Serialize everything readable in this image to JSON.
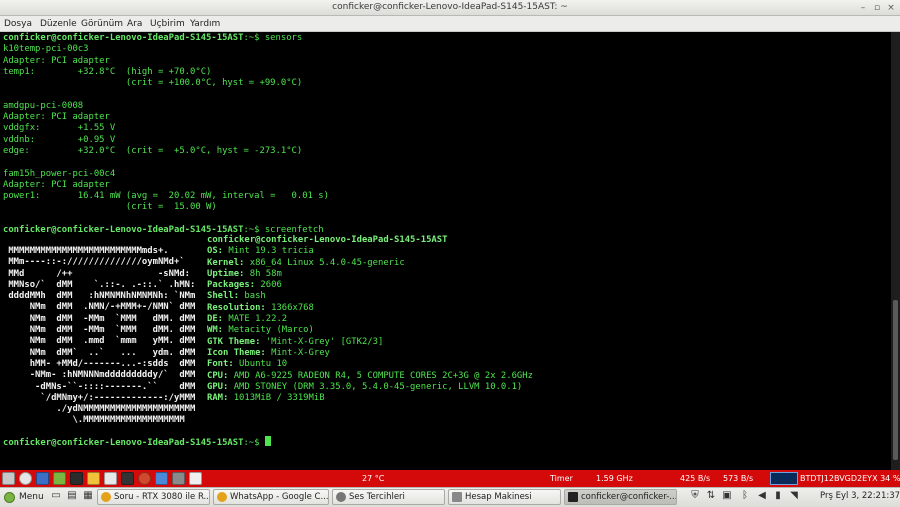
{
  "window": {
    "title": "conficker@conficker-Lenovo-IdeaPad-S145-15AST: ~",
    "minimize_glyph": "–",
    "maximize_glyph": "▫",
    "close_glyph": "×"
  },
  "menubar": [
    "Dosya",
    "Düzenle",
    "Görünüm",
    "Ara",
    "Uçbirim",
    "Yardım"
  ],
  "prompt": "conficker@conficker-Lenovo-IdeaPad-S145-15AST",
  "prompt_suffix": ":~$",
  "commands": {
    "first": " sensors",
    "second": " screenfetch",
    "third": " "
  },
  "sensors_output": [
    "k10temp-pci-00c3",
    "Adapter: PCI adapter",
    "temp1:        +32.8°C  (high = +70.0°C)",
    "                       (crit = +100.0°C, hyst = +99.0°C)",
    "",
    "amdgpu-pci-0008",
    "Adapter: PCI adapter",
    "vddgfx:       +1.55 V",
    "vddnb:        +0.95 V",
    "edge:         +32.0°C  (crit =  +5.0°C, hyst = -273.1°C)",
    "",
    "fam15h_power-pci-00c4",
    "Adapter: PCI adapter",
    "power1:       16.41 mW (avg =  20.02 mW, interval =   0.01 s)",
    "                       (crit =  15.00 W)",
    ""
  ],
  "logo_lines": [
    " MMMMMMMMMMMMMMMMMMMMMMMMMmds+.",
    " MMm----::-://////////////oymNMd+`",
    " MMd      /++                -sNMd:",
    " MMNso/`  dMM    `.::-. .-::.` .hMN:",
    " ddddMMh  dMM   :hNMNMNhNMNMNh: `NMm",
    "     NMm  dMM  .NMN/-+MMM+-/NMN` dMM",
    "     NMm  dMM  -MMm  `MMM   dMM. dMM",
    "     NMm  dMM  -MMm  `MMM   dMM. dMM",
    "     NMm  dMM  .mmd  `mmm   yMM. dMM",
    "     NMm  dMM`  ..`   ...   ydm. dMM",
    "     hMM- +MMd/-------...-:sdds  dMM",
    "     -NMm- :hNMNNNmdddddddddy/`  dMM",
    "      -dMNs-``-::::-------.``    dMM",
    "       `/dMNmy+/:-------------:/yMMM",
    "          ./ydNMMMMMMMMMMMMMMMMMMMMM",
    "             \\.MMMMMMMMMMMMMMMMMMM"
  ],
  "screenfetch": {
    "header": "conficker@conficker-Lenovo-IdeaPad-S145-15AST",
    "items": [
      {
        "label": "OS:",
        "value": " Mint 19.3 tricia"
      },
      {
        "label": "Kernel:",
        "value": " x86_64 Linux 5.4.0-45-generic"
      },
      {
        "label": "Uptime:",
        "value": " 8h 58m"
      },
      {
        "label": "Packages:",
        "value": " 2606"
      },
      {
        "label": "Shell:",
        "value": " bash"
      },
      {
        "label": "Resolution:",
        "value": " 1366x768"
      },
      {
        "label": "DE:",
        "value": " MATE 1.22.2"
      },
      {
        "label": "WM:",
        "value": " Metacity (Marco)"
      },
      {
        "label": "GTK Theme:",
        "value": " 'Mint-X-Grey' [GTK2/3]"
      },
      {
        "label": "Icon Theme:",
        "value": " Mint-X-Grey"
      },
      {
        "label": "Font:",
        "value": " Ubuntu 10"
      },
      {
        "label": "CPU:",
        "value": " AMD A6-9225 RADEON R4, 5 COMPUTE CORES 2C+3G @ 2x 2.6GHz"
      },
      {
        "label": "GPU:",
        "value": " AMD STONEY (DRM 3.35.0, 5.4.0-45-generic, LLVM 10.0.1)"
      },
      {
        "label": "RAM:",
        "value": " 1013MiB / 3319MiB"
      }
    ]
  },
  "top_panel": {
    "temperature": "27 °C",
    "timer": "Timer",
    "cpu_freq": "1.59 GHz",
    "net_down": "425 B/s",
    "net_up": "573 B/s",
    "ssid": "BTDTJ12BVGD2EYX 34 %",
    "colors": {
      "background": "#d40a0a"
    }
  },
  "taskbar": {
    "menu_label": "Menu",
    "tasks": [
      {
        "label": "Soru - RTX 3080 ile R...",
        "icon": "chrome-icon"
      },
      {
        "label": "WhatsApp - Google C...",
        "icon": "chrome-icon"
      },
      {
        "label": "Ses Tercihleri",
        "icon": "sound-icon"
      },
      {
        "label": "Hesap Makinesi",
        "icon": "calculator-icon"
      },
      {
        "label": "conficker@conficker-...",
        "icon": "terminal-icon"
      }
    ],
    "clock": "Prş Eyl  3, 22:21:37"
  }
}
